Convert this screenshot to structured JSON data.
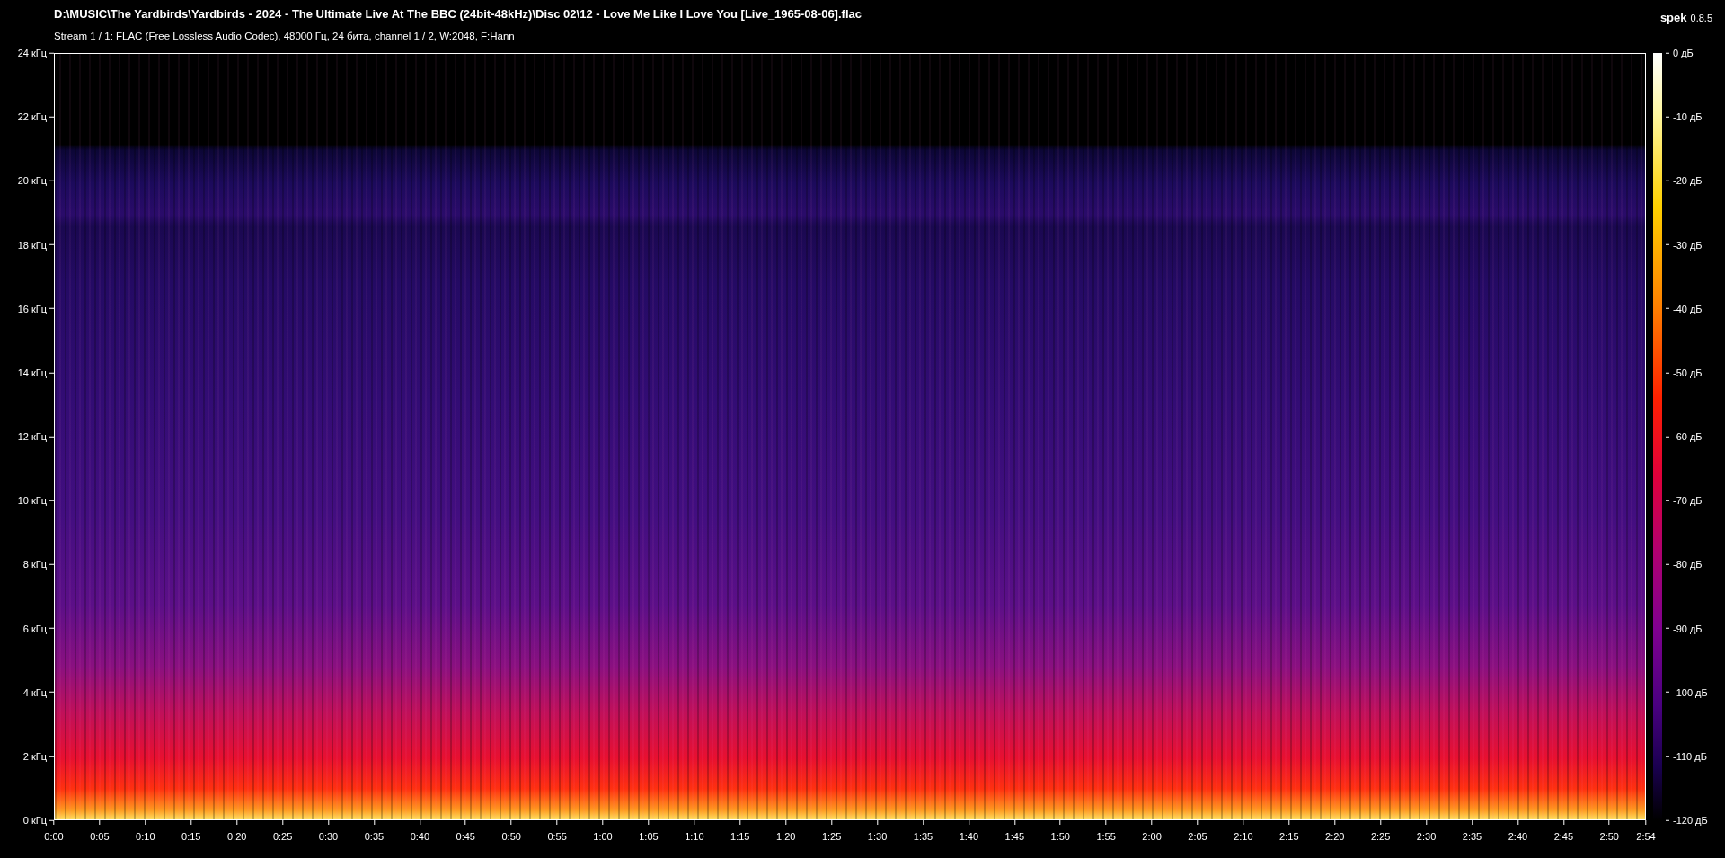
{
  "title": "D:\\MUSIC\\The Yardbirds\\Yardbirds - 2024 - The Ultimate Live At The BBC (24bit-48kHz)\\Disc 02\\12 - Love Me Like I Love You [Live_1965-08-06].flac",
  "subtitle": "Stream 1 / 1: FLAC (Free Lossless Audio Codec), 48000 Гц, 24 бита, channel 1 / 2, W:2048, F:Hann",
  "app": {
    "name": "spek",
    "version": "0.8.5"
  },
  "frequency_axis": [
    "24 кГц",
    "22 кГц",
    "20 кГц",
    "18 кГц",
    "16 кГц",
    "14 кГц",
    "12 кГц",
    "10 кГц",
    "8 кГц",
    "6 кГц",
    "4 кГц",
    "2 кГц",
    "0 кГц"
  ],
  "time_axis": [
    "0:00",
    "0:05",
    "0:10",
    "0:15",
    "0:20",
    "0:25",
    "0:30",
    "0:35",
    "0:40",
    "0:45",
    "0:50",
    "0:55",
    "1:00",
    "1:05",
    "1:10",
    "1:15",
    "1:20",
    "1:25",
    "1:30",
    "1:35",
    "1:40",
    "1:45",
    "1:50",
    "1:55",
    "2:00",
    "2:05",
    "2:10",
    "2:15",
    "2:20",
    "2:25",
    "2:30",
    "2:35",
    "2:40",
    "2:45",
    "2:50",
    "2:54"
  ],
  "db_scale": [
    "0 дБ",
    "-10 дБ",
    "-20 дБ",
    "-30 дБ",
    "-40 дБ",
    "-50 дБ",
    "-60 дБ",
    "-70 дБ",
    "-80 дБ",
    "-90 дБ",
    "-100 дБ",
    "-110 дБ",
    "-120 дБ"
  ]
}
